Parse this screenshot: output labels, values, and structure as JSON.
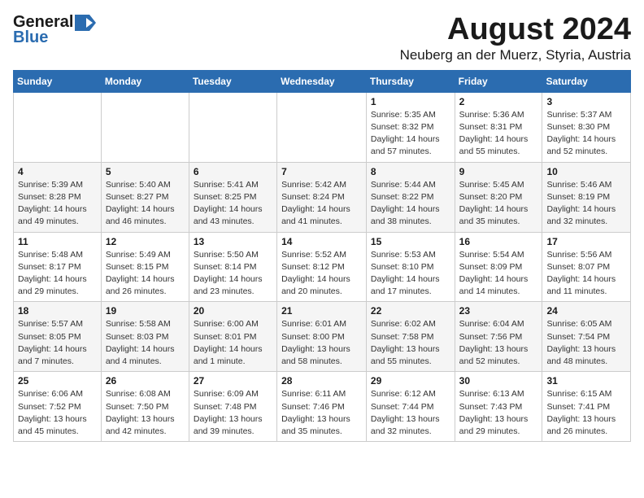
{
  "header": {
    "logo_general": "General",
    "logo_blue": "Blue",
    "month_title": "August 2024",
    "subtitle": "Neuberg an der Muerz, Styria, Austria"
  },
  "calendar": {
    "days_of_week": [
      "Sunday",
      "Monday",
      "Tuesday",
      "Wednesday",
      "Thursday",
      "Friday",
      "Saturday"
    ],
    "weeks": [
      [
        {
          "day": "",
          "detail": ""
        },
        {
          "day": "",
          "detail": ""
        },
        {
          "day": "",
          "detail": ""
        },
        {
          "day": "",
          "detail": ""
        },
        {
          "day": "1",
          "detail": "Sunrise: 5:35 AM\nSunset: 8:32 PM\nDaylight: 14 hours and 57 minutes."
        },
        {
          "day": "2",
          "detail": "Sunrise: 5:36 AM\nSunset: 8:31 PM\nDaylight: 14 hours and 55 minutes."
        },
        {
          "day": "3",
          "detail": "Sunrise: 5:37 AM\nSunset: 8:30 PM\nDaylight: 14 hours and 52 minutes."
        }
      ],
      [
        {
          "day": "4",
          "detail": "Sunrise: 5:39 AM\nSunset: 8:28 PM\nDaylight: 14 hours and 49 minutes."
        },
        {
          "day": "5",
          "detail": "Sunrise: 5:40 AM\nSunset: 8:27 PM\nDaylight: 14 hours and 46 minutes."
        },
        {
          "day": "6",
          "detail": "Sunrise: 5:41 AM\nSunset: 8:25 PM\nDaylight: 14 hours and 43 minutes."
        },
        {
          "day": "7",
          "detail": "Sunrise: 5:42 AM\nSunset: 8:24 PM\nDaylight: 14 hours and 41 minutes."
        },
        {
          "day": "8",
          "detail": "Sunrise: 5:44 AM\nSunset: 8:22 PM\nDaylight: 14 hours and 38 minutes."
        },
        {
          "day": "9",
          "detail": "Sunrise: 5:45 AM\nSunset: 8:20 PM\nDaylight: 14 hours and 35 minutes."
        },
        {
          "day": "10",
          "detail": "Sunrise: 5:46 AM\nSunset: 8:19 PM\nDaylight: 14 hours and 32 minutes."
        }
      ],
      [
        {
          "day": "11",
          "detail": "Sunrise: 5:48 AM\nSunset: 8:17 PM\nDaylight: 14 hours and 29 minutes."
        },
        {
          "day": "12",
          "detail": "Sunrise: 5:49 AM\nSunset: 8:15 PM\nDaylight: 14 hours and 26 minutes."
        },
        {
          "day": "13",
          "detail": "Sunrise: 5:50 AM\nSunset: 8:14 PM\nDaylight: 14 hours and 23 minutes."
        },
        {
          "day": "14",
          "detail": "Sunrise: 5:52 AM\nSunset: 8:12 PM\nDaylight: 14 hours and 20 minutes."
        },
        {
          "day": "15",
          "detail": "Sunrise: 5:53 AM\nSunset: 8:10 PM\nDaylight: 14 hours and 17 minutes."
        },
        {
          "day": "16",
          "detail": "Sunrise: 5:54 AM\nSunset: 8:09 PM\nDaylight: 14 hours and 14 minutes."
        },
        {
          "day": "17",
          "detail": "Sunrise: 5:56 AM\nSunset: 8:07 PM\nDaylight: 14 hours and 11 minutes."
        }
      ],
      [
        {
          "day": "18",
          "detail": "Sunrise: 5:57 AM\nSunset: 8:05 PM\nDaylight: 14 hours and 7 minutes."
        },
        {
          "day": "19",
          "detail": "Sunrise: 5:58 AM\nSunset: 8:03 PM\nDaylight: 14 hours and 4 minutes."
        },
        {
          "day": "20",
          "detail": "Sunrise: 6:00 AM\nSunset: 8:01 PM\nDaylight: 14 hours and 1 minute."
        },
        {
          "day": "21",
          "detail": "Sunrise: 6:01 AM\nSunset: 8:00 PM\nDaylight: 13 hours and 58 minutes."
        },
        {
          "day": "22",
          "detail": "Sunrise: 6:02 AM\nSunset: 7:58 PM\nDaylight: 13 hours and 55 minutes."
        },
        {
          "day": "23",
          "detail": "Sunrise: 6:04 AM\nSunset: 7:56 PM\nDaylight: 13 hours and 52 minutes."
        },
        {
          "day": "24",
          "detail": "Sunrise: 6:05 AM\nSunset: 7:54 PM\nDaylight: 13 hours and 48 minutes."
        }
      ],
      [
        {
          "day": "25",
          "detail": "Sunrise: 6:06 AM\nSunset: 7:52 PM\nDaylight: 13 hours and 45 minutes."
        },
        {
          "day": "26",
          "detail": "Sunrise: 6:08 AM\nSunset: 7:50 PM\nDaylight: 13 hours and 42 minutes."
        },
        {
          "day": "27",
          "detail": "Sunrise: 6:09 AM\nSunset: 7:48 PM\nDaylight: 13 hours and 39 minutes."
        },
        {
          "day": "28",
          "detail": "Sunrise: 6:11 AM\nSunset: 7:46 PM\nDaylight: 13 hours and 35 minutes."
        },
        {
          "day": "29",
          "detail": "Sunrise: 6:12 AM\nSunset: 7:44 PM\nDaylight: 13 hours and 32 minutes."
        },
        {
          "day": "30",
          "detail": "Sunrise: 6:13 AM\nSunset: 7:43 PM\nDaylight: 13 hours and 29 minutes."
        },
        {
          "day": "31",
          "detail": "Sunrise: 6:15 AM\nSunset: 7:41 PM\nDaylight: 13 hours and 26 minutes."
        }
      ]
    ]
  }
}
